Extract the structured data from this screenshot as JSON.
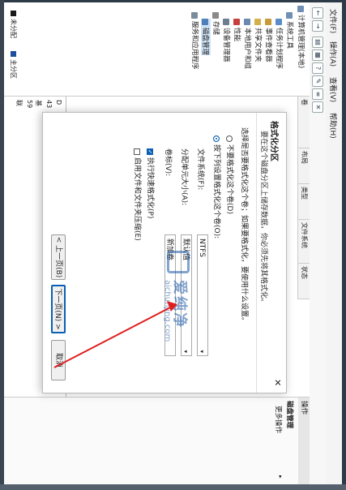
{
  "menu": [
    "文件(F)",
    "操作(A)",
    "查看(V)",
    "帮助(H)"
  ],
  "tree": {
    "root": "计算机管理(本地)",
    "items": [
      {
        "label": "系统工具",
        "level": 1,
        "color": "#6f8fb5"
      },
      {
        "label": "任务计划程序",
        "level": 2,
        "color": "#5a8dc8"
      },
      {
        "label": "事件查看器",
        "level": 2,
        "color": "#c99a3a"
      },
      {
        "label": "共享文件夹",
        "level": 2,
        "color": "#d4b04a"
      },
      {
        "label": "本地用户和组",
        "level": 2,
        "color": "#6b89b0"
      },
      {
        "label": "性能",
        "level": 2,
        "color": "#c74040"
      },
      {
        "label": "设备管理器",
        "level": 2,
        "color": "#6b7d8e"
      },
      {
        "label": "存储",
        "level": 1,
        "color": "#8a8a8a"
      },
      {
        "label": "磁盘管理",
        "level": 2,
        "color": "#4f7fb9"
      },
      {
        "label": "服务和应用程序",
        "level": 1,
        "color": "#7a8c9c"
      }
    ]
  },
  "columns": [
    "卷",
    "布局",
    "类型",
    "文件系统",
    "状态"
  ],
  "disk_rows": [
    "D",
    "43",
    "基",
    "59",
    "联"
  ],
  "disk_legend": [
    "未分配",
    "主分区"
  ],
  "legend_colors": {
    "unalloc": "#1a1a1a",
    "primary": "#1e4f9c"
  },
  "ops": {
    "header": "操作",
    "section": "磁盘管理",
    "more": "更多操作"
  },
  "dialog": {
    "title": "格式化分区",
    "subtitle": "要在这个磁盘分区上储存数据，你必须先将其格式化。",
    "prompt": "选择是否要格式化这个卷；如果要格式化，要使用什么设置。",
    "opt_none": "不要格式化这个卷(D)",
    "opt_format": "按下列设置格式化这个卷(O):",
    "fs_label": "文件系统(F):",
    "fs_value": "NTFS",
    "alloc_label": "分配单元大小(A):",
    "alloc_value": "默认值",
    "vol_label": "卷标(V):",
    "vol_value": "新加卷",
    "quick_format": "执行快速格式化(P)",
    "compress": "启用文件和文件夹压缩(E)",
    "back_btn": "< 上一页(B)",
    "next_btn": "下一页(N) >",
    "cancel_btn": "取消"
  },
  "watermark": {
    "cn": "爱纯净",
    "en": "aichunjing.com"
  },
  "arrow_color": "#e02020"
}
